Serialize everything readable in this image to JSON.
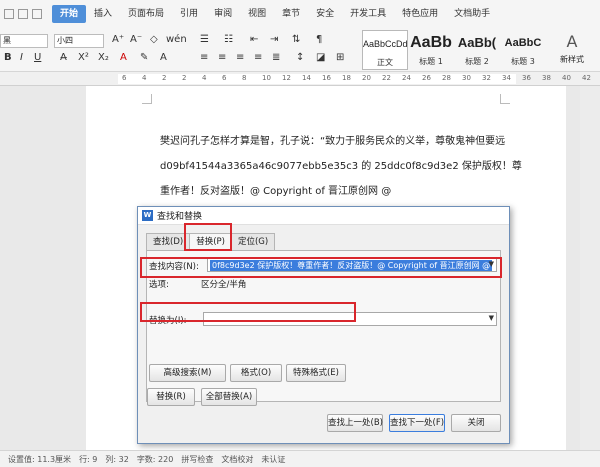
{
  "menubar": {
    "tabs": [
      "开始",
      "插入",
      "页面布局",
      "引用",
      "审阅",
      "视图",
      "章节",
      "安全",
      "开发工具",
      "特色应用",
      "文档助手"
    ],
    "active_tab": "开始"
  },
  "ribbon": {
    "font_name": "黑",
    "font_size": "小四",
    "styles": [
      {
        "sample": "AaBbCcDd",
        "name": "正文"
      },
      {
        "sample": "AaBb",
        "name": "标题 1"
      },
      {
        "sample": "AaBb(",
        "name": "标题 2"
      },
      {
        "sample": "AaBbC",
        "name": "标题 3"
      }
    ],
    "new_style_label": "新样式"
  },
  "ruler": {
    "ticks": [
      "6",
      "4",
      "2",
      "2",
      "4",
      "6",
      "8",
      "10",
      "12",
      "14",
      "16",
      "18",
      "20",
      "22",
      "24",
      "26",
      "28",
      "30",
      "32",
      "34",
      "36",
      "38",
      "40",
      "42"
    ]
  },
  "document": {
    "lines": [
      "樊迟问孔子怎样才算是智，孔子说：“致力于服务民众的义举，尊敬鬼神但要远",
      "d09bf41544a3365a46c9077ebb5e35c3 的 25ddc0f8c9d3e2 保护版权！尊",
      "重作者！反对盗版！@ Copyright of 晋江原创网 @"
    ]
  },
  "dialog": {
    "title": "查找和替换",
    "tabs": [
      "查找(D)",
      "替换(P)",
      "定位(G)"
    ],
    "active_tab": "替换(P)",
    "find_label": "查找内容(N):",
    "find_value": "0f8c9d3e2 保护版权！尊重作者！反对盗版！@ Copyright of 晋江原创网 @",
    "options_label": "选项:",
    "options_value": "区分全/半角",
    "replace_label": "替换为(I):",
    "replace_value": "",
    "buttons": {
      "advanced": "高级搜索(M)",
      "format": "格式(O)",
      "special": "特殊格式(E)",
      "replace": "替换(R)",
      "replace_all": "全部替换(A)",
      "find_prev": "查找上一处(B)",
      "find_next": "查找下一处(F)",
      "close": "关闭"
    }
  },
  "statusbar": {
    "position": "设置值: 11.3厘米",
    "row": "行: 9",
    "col": "列: 32",
    "word_count": "字数: 220",
    "spell_check": "拼写检查",
    "doc_check": "文档校对",
    "cert": "未认证"
  },
  "colors": {
    "accent": "#4f8fd9",
    "selection": "#3b7ddd",
    "annotation_red": "#d9262c"
  }
}
